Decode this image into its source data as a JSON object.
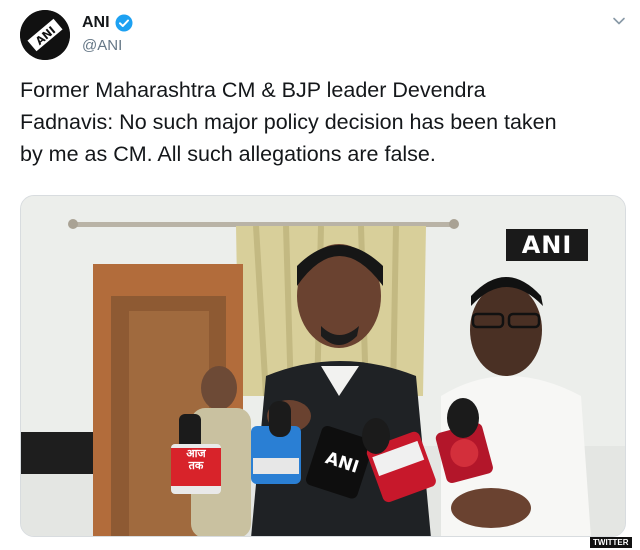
{
  "tweet": {
    "author_name": "ANI",
    "handle": "@ANI",
    "text": "Former Maharashtra CM & BJP leader Devendra\nFadnavis: No such major policy decision has been taken\nby me as CM. All such allegations are false.",
    "verified": true
  },
  "media": {
    "watermark": "ANI",
    "mic_labels": {
      "aaj_tak": "आज\nतक",
      "ani": "ANI"
    }
  },
  "source_label": "TWITTER",
  "colors": {
    "text": "#14171a",
    "secondary": "#657786",
    "verified": "#1da1f2"
  },
  "icons": [
    "avatar-logo",
    "verified-icon",
    "caret-down-icon"
  ]
}
